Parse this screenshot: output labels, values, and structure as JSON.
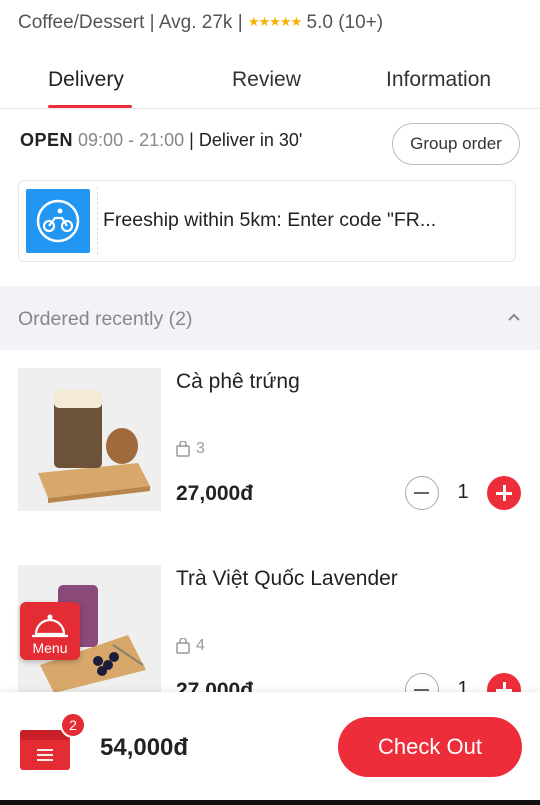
{
  "store": {
    "category": "Coffee/Dessert",
    "avg_label": "Avg. 27k",
    "stars": "★★★★★",
    "rating": "5.0 (10+)"
  },
  "tabs": [
    {
      "label": "Delivery",
      "active": true
    },
    {
      "label": "Review",
      "active": false
    },
    {
      "label": "Information",
      "active": false
    }
  ],
  "status": {
    "open_label": "OPEN",
    "hours": "09:00 - 21:00",
    "delivery": "| Deliver in 30'",
    "group_order_label": "Group order"
  },
  "promo": {
    "icon": "delivery-bike-icon",
    "text": "Freeship within 5km: Enter code \"FR..."
  },
  "section": {
    "title": "Ordered recently (2)",
    "icon": "chevron-up-icon"
  },
  "items": [
    {
      "name": "Cà phê trứng",
      "sold": "3",
      "price": "27,000đ",
      "qty": "1"
    },
    {
      "name": "Trà Việt Quốc Lavender",
      "sold": "4",
      "price": "27,000đ",
      "qty": "1"
    }
  ],
  "menu_fab": {
    "label": "Menu",
    "icon": "bell-icon"
  },
  "cart": {
    "count": "2",
    "total": "54,000đ",
    "checkout_label": "Check Out",
    "icon": "cart-box-icon"
  },
  "colors": {
    "accent": "#ee2d3a",
    "promo_blue": "#2196f3",
    "star": "#f5b301"
  }
}
